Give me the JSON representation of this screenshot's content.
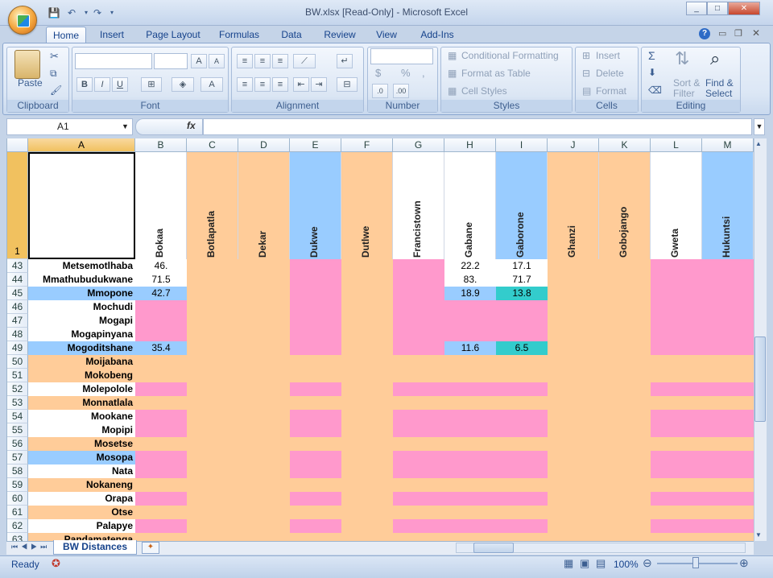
{
  "window": {
    "title": "BW.xlsx  [Read-Only] - Microsoft Excel",
    "min": "_",
    "max": "□",
    "close": "✕"
  },
  "qat": {
    "save": "💾",
    "undo": "↶",
    "redo": "↷",
    "more": "▾"
  },
  "tabs": [
    "Home",
    "Insert",
    "Page Layout",
    "Formulas",
    "Data",
    "Review",
    "View",
    "Add-Ins"
  ],
  "ribbon": {
    "clipboard": {
      "label": "Clipboard",
      "paste": "Paste"
    },
    "font": {
      "label": "Font",
      "bold": "B",
      "italic": "I",
      "underline": "U"
    },
    "alignment": {
      "label": "Alignment"
    },
    "number": {
      "label": "Number",
      "currency": "$",
      "percent": "%",
      "comma": ","
    },
    "styles": {
      "label": "Styles",
      "conditional": "Conditional Formatting",
      "table": "Format as Table",
      "cell": "Cell Styles"
    },
    "cells": {
      "label": "Cells",
      "insert": "Insert",
      "delete": "Delete",
      "format": "Format"
    },
    "editing": {
      "label": "Editing",
      "sort1": "Sort &",
      "sort2": "Filter",
      "find1": "Find &",
      "find2": "Select"
    }
  },
  "formula_bar": {
    "name_box": "A1",
    "fx": "fx",
    "formula": ""
  },
  "columns": [
    "A",
    "B",
    "C",
    "D",
    "E",
    "F",
    "G",
    "H",
    "I",
    "J",
    "K",
    "L",
    "M"
  ],
  "header_row_number": "1",
  "cities": [
    "Bokaa",
    "Botlapatla",
    "Dekar",
    "Dukwe",
    "Dutlwe",
    "Francistown",
    "Gabane",
    "Gaborone",
    "Ghanzi",
    "Gobojango",
    "Gweta",
    "Hukuntsi"
  ],
  "rows": [
    {
      "n": "43",
      "name": "Metsemotlhaba",
      "B": "46.",
      "H": "22.2",
      "I": "17.1"
    },
    {
      "n": "44",
      "name": "Mmathubudukwane",
      "B": "71.5",
      "H": "83.",
      "I": "71.7"
    },
    {
      "n": "45",
      "name": "Mmopone",
      "B": "42.7",
      "H": "18.9",
      "I": "13.8"
    },
    {
      "n": "46",
      "name": "Mochudi"
    },
    {
      "n": "47",
      "name": "Mogapi"
    },
    {
      "n": "48",
      "name": "Mogapinyana"
    },
    {
      "n": "49",
      "name": "Mogoditshane",
      "B": "35.4",
      "H": "11.6",
      "I": "6.5"
    },
    {
      "n": "50",
      "name": "Moijabana"
    },
    {
      "n": "51",
      "name": "Mokobeng"
    },
    {
      "n": "52",
      "name": "Molepolole"
    },
    {
      "n": "53",
      "name": "Monnatlala"
    },
    {
      "n": "54",
      "name": "Mookane"
    },
    {
      "n": "55",
      "name": "Mopipi"
    },
    {
      "n": "56",
      "name": "Mosetse"
    },
    {
      "n": "57",
      "name": "Mosopa"
    },
    {
      "n": "58",
      "name": "Nata"
    },
    {
      "n": "59",
      "name": "Nokaneng"
    },
    {
      "n": "60",
      "name": "Orapa"
    },
    {
      "n": "61",
      "name": "Otse"
    },
    {
      "n": "62",
      "name": "Palapye"
    },
    {
      "n": "63",
      "name": "Pandamatenga"
    }
  ],
  "sheet": {
    "tab": "BW Distances"
  },
  "status": {
    "ready": "Ready",
    "zoom": "100%"
  },
  "colors": {
    "peach": "#ffcc99",
    "pink": "#ff99cc",
    "blue": "#99ccff",
    "teal": "#33cccc",
    "white": "#ffffff"
  }
}
